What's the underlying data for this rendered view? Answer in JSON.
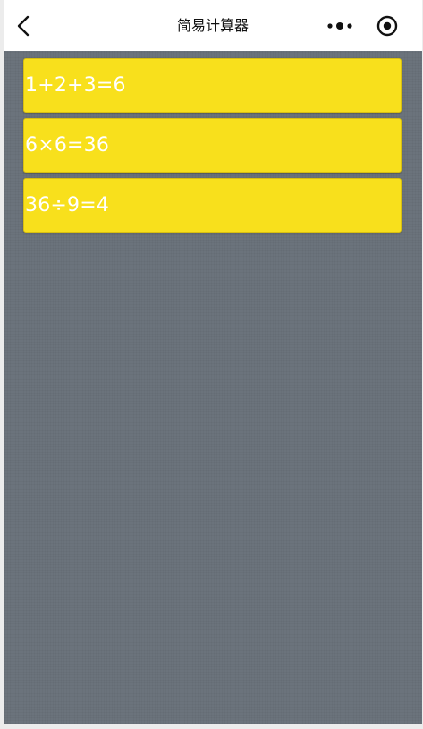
{
  "navbar": {
    "title": "简易计算器",
    "back_icon": "chevron-left-icon",
    "more_icon": "more-dots-icon",
    "capsule_icon": "target-circle-icon"
  },
  "results": {
    "items": [
      {
        "expression": "1+2+3=6"
      },
      {
        "expression": "6×6=36"
      },
      {
        "expression": "36÷9=4"
      }
    ]
  },
  "colors": {
    "background": "#6b737c",
    "card": "#f8e01c",
    "card_text": "#ffffff",
    "navbar": "#ffffff"
  }
}
